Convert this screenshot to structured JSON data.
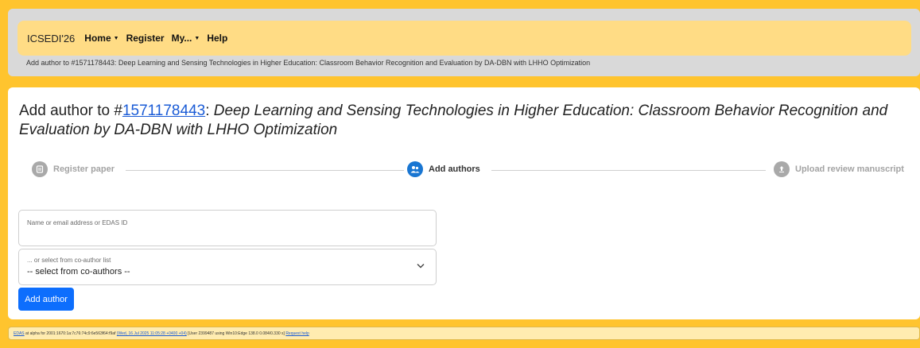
{
  "nav": {
    "brand": "ICSEDI'26",
    "items": [
      {
        "label": "Home",
        "dropdown": true
      },
      {
        "label": "Register",
        "dropdown": false
      },
      {
        "label": "My...",
        "dropdown": true
      },
      {
        "label": "Help",
        "dropdown": false
      }
    ],
    "caret": "▼"
  },
  "breadcrumb": "Add author to #1571178443: Deep Learning and Sensing Technologies in Higher Education: Classroom Behavior Recognition and Evaluation by DA-DBN with LHHO Optimization",
  "title": {
    "prefix": "Add author to #",
    "paper_id": "1571178443",
    "colon": ":",
    "paper_title": "Deep Learning and Sensing Technologies in Higher Education: Classroom Behavior Recognition and Evaluation by DA-DBN with LHHO Optimization"
  },
  "steps": [
    {
      "label": "Register paper",
      "state": "done",
      "icon": "document-icon"
    },
    {
      "label": "Add authors",
      "state": "active",
      "icon": "users-icon"
    },
    {
      "label": "Upload review manuscript",
      "state": "pending",
      "icon": "upload-icon"
    }
  ],
  "form": {
    "author_input": {
      "placeholder": "Name or email address or EDAS ID",
      "value": ""
    },
    "coauthor_select": {
      "label": "... or select from co-author list",
      "value": "-- select from co-authors --"
    },
    "submit_label": "Add author"
  },
  "footer": {
    "edas_link": "EDAS",
    "text1": " at alpha for 2001:1670:1a:7c76:74c9:6e563f64:f9af ",
    "date_link": "(Wed, 16 Jul 2025 11:05:28 +0400 +04)",
    "text2": " [User 2399487 using Win10:Edge 138.0 0.084/0.330 s] ",
    "help_link": "Request help"
  },
  "colors": {
    "accent": "#1976d2",
    "button": "#0d6efd",
    "background": "#ffc42e",
    "navbar": "#ffdc85"
  }
}
